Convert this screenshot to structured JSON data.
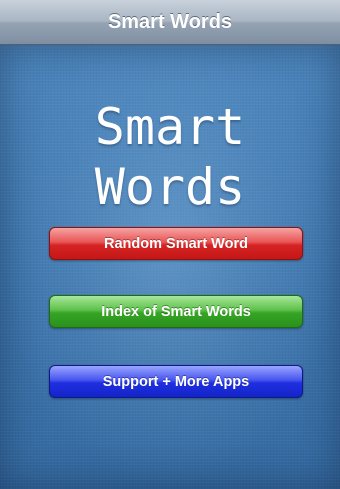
{
  "nav_bar": {
    "title": "Smart Words"
  },
  "main": {
    "app_title_line1": "Smart",
    "app_title_line2": "Words",
    "buttons": [
      {
        "label": "Random Smart Word",
        "color": "#d62424"
      },
      {
        "label": "Index of Smart Words",
        "color": "#36a425"
      },
      {
        "label": "Support + More Apps",
        "color": "#1f2fe0"
      }
    ]
  },
  "colors": {
    "background_blue": "#3f77ae",
    "nav_bar": "#95a3b3"
  }
}
